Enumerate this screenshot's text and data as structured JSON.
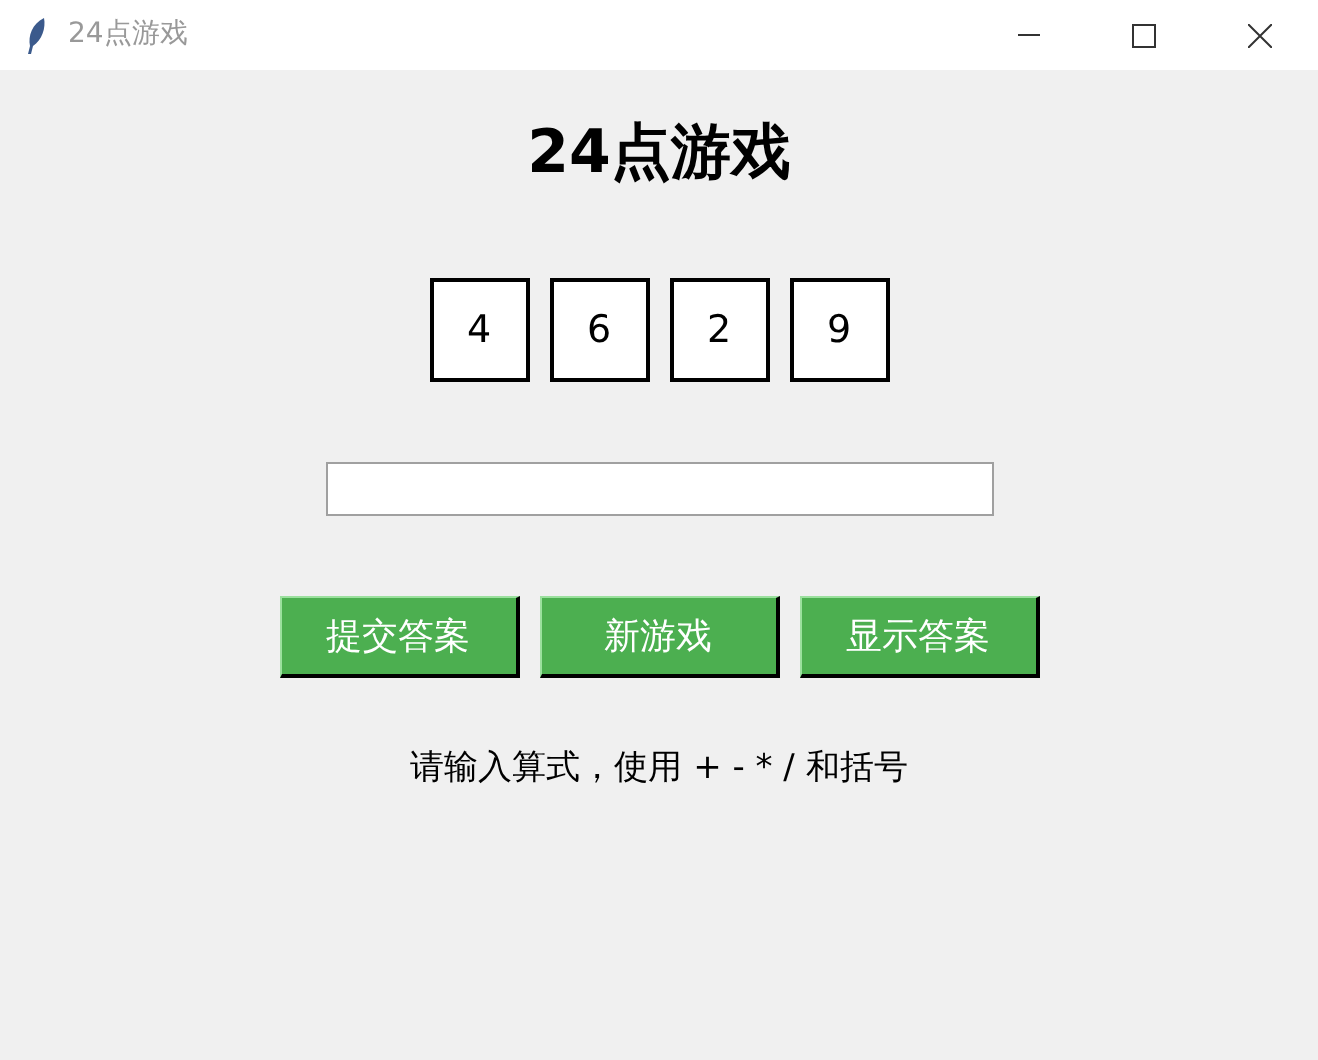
{
  "window": {
    "title": "24点游戏"
  },
  "heading": "24点游戏",
  "cards": [
    "4",
    "6",
    "2",
    "9"
  ],
  "buttons": [
    "提交答案",
    "新游戏",
    "显示答案"
  ],
  "hint": "请输入算式，使用 + - * / 和括号"
}
